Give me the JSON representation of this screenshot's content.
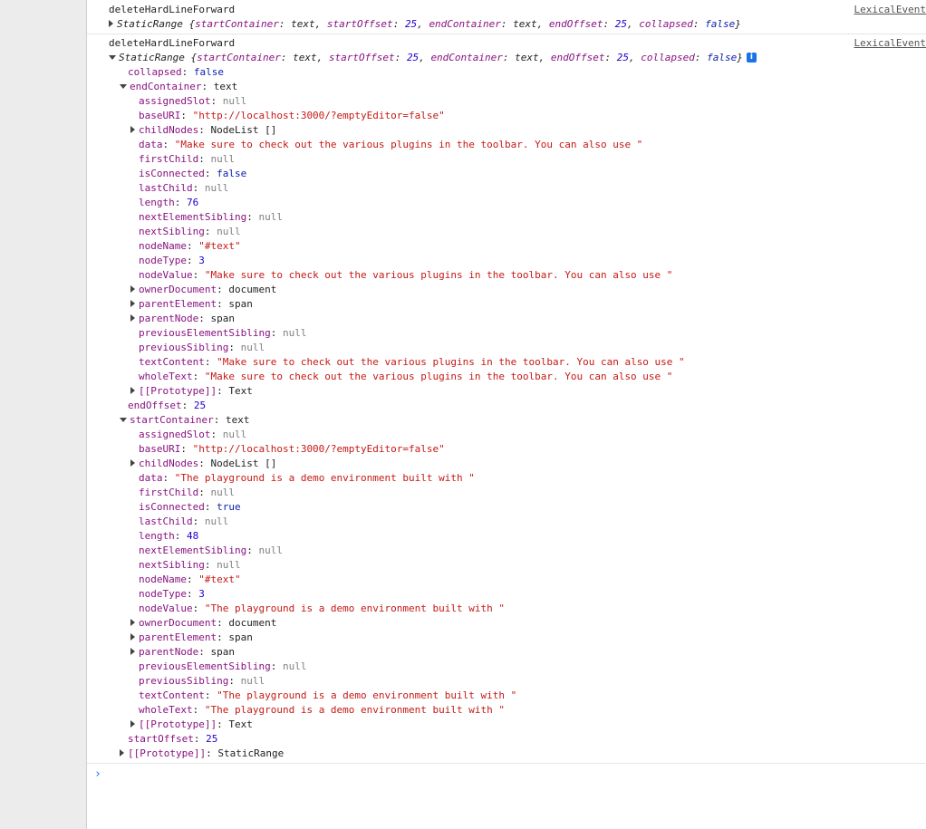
{
  "source_link": "LexicalEvent",
  "messages": [
    {
      "label": "deleteHardLineForward",
      "summary": {
        "class": "StaticRange",
        "open_brace": " {",
        "props": [
          {
            "key": "startContainer",
            "value": "text",
            "kind": "obj"
          },
          {
            "key": "startOffset",
            "value": "25",
            "kind": "num"
          },
          {
            "key": "endContainer",
            "value": "text",
            "kind": "obj"
          },
          {
            "key": "endOffset",
            "value": "25",
            "kind": "num"
          },
          {
            "key": "collapsed",
            "value": "false",
            "kind": "kw"
          }
        ],
        "close_brace": "}"
      }
    },
    {
      "label": "deleteHardLineForward",
      "summary": {
        "class": "StaticRange",
        "open_brace": " {",
        "props": [
          {
            "key": "startContainer",
            "value": "text",
            "kind": "obj"
          },
          {
            "key": "startOffset",
            "value": "25",
            "kind": "num"
          },
          {
            "key": "endContainer",
            "value": "text",
            "kind": "obj"
          },
          {
            "key": "endOffset",
            "value": "25",
            "kind": "num"
          },
          {
            "key": "collapsed",
            "value": "false",
            "kind": "kw"
          }
        ],
        "close_brace": "}"
      },
      "info_icon": "i",
      "tree": [
        {
          "depth": 0,
          "key": "collapsed",
          "value": "false",
          "kind": "kw",
          "toggle": "none"
        },
        {
          "depth": 0,
          "key": "endContainer",
          "value": "text",
          "kind": "obj",
          "toggle": "open"
        },
        {
          "depth": 1,
          "key": "assignedSlot",
          "value": "null",
          "kind": "nul",
          "toggle": "none"
        },
        {
          "depth": 1,
          "key": "baseURI",
          "value": "\"http://localhost:3000/?emptyEditor=false\"",
          "kind": "str",
          "toggle": "none"
        },
        {
          "depth": 1,
          "key": "childNodes",
          "value": "NodeList []",
          "kind": "obj",
          "toggle": "closed"
        },
        {
          "depth": 1,
          "key": "data",
          "value": "\"Make sure to check out the various plugins in the toolbar. You can also use \"",
          "kind": "str",
          "toggle": "none"
        },
        {
          "depth": 1,
          "key": "firstChild",
          "value": "null",
          "kind": "nul",
          "toggle": "none"
        },
        {
          "depth": 1,
          "key": "isConnected",
          "value": "false",
          "kind": "kw",
          "toggle": "none"
        },
        {
          "depth": 1,
          "key": "lastChild",
          "value": "null",
          "kind": "nul",
          "toggle": "none"
        },
        {
          "depth": 1,
          "key": "length",
          "value": "76",
          "kind": "num",
          "toggle": "none"
        },
        {
          "depth": 1,
          "key": "nextElementSibling",
          "value": "null",
          "kind": "nul",
          "toggle": "none"
        },
        {
          "depth": 1,
          "key": "nextSibling",
          "value": "null",
          "kind": "nul",
          "toggle": "none"
        },
        {
          "depth": 1,
          "key": "nodeName",
          "value": "\"#text\"",
          "kind": "str",
          "toggle": "none"
        },
        {
          "depth": 1,
          "key": "nodeType",
          "value": "3",
          "kind": "num",
          "toggle": "none"
        },
        {
          "depth": 1,
          "key": "nodeValue",
          "value": "\"Make sure to check out the various plugins in the toolbar. You can also use \"",
          "kind": "str",
          "toggle": "none"
        },
        {
          "depth": 1,
          "key": "ownerDocument",
          "value": "document",
          "kind": "obj",
          "toggle": "closed"
        },
        {
          "depth": 1,
          "key": "parentElement",
          "value": "span",
          "kind": "obj",
          "toggle": "closed"
        },
        {
          "depth": 1,
          "key": "parentNode",
          "value": "span",
          "kind": "obj",
          "toggle": "closed"
        },
        {
          "depth": 1,
          "key": "previousElementSibling",
          "value": "null",
          "kind": "nul",
          "toggle": "none"
        },
        {
          "depth": 1,
          "key": "previousSibling",
          "value": "null",
          "kind": "nul",
          "toggle": "none"
        },
        {
          "depth": 1,
          "key": "textContent",
          "value": "\"Make sure to check out the various plugins in the toolbar. You can also use \"",
          "kind": "str",
          "toggle": "none"
        },
        {
          "depth": 1,
          "key": "wholeText",
          "value": "\"Make sure to check out the various plugins in the toolbar. You can also use \"",
          "kind": "str",
          "toggle": "none"
        },
        {
          "depth": 1,
          "key": "[[Prototype]]",
          "value": "Text",
          "kind": "obj",
          "toggle": "closed"
        },
        {
          "depth": 0,
          "key": "endOffset",
          "value": "25",
          "kind": "num",
          "toggle": "none"
        },
        {
          "depth": 0,
          "key": "startContainer",
          "value": "text",
          "kind": "obj",
          "toggle": "open"
        },
        {
          "depth": 1,
          "key": "assignedSlot",
          "value": "null",
          "kind": "nul",
          "toggle": "none"
        },
        {
          "depth": 1,
          "key": "baseURI",
          "value": "\"http://localhost:3000/?emptyEditor=false\"",
          "kind": "str",
          "toggle": "none"
        },
        {
          "depth": 1,
          "key": "childNodes",
          "value": "NodeList []",
          "kind": "obj",
          "toggle": "closed"
        },
        {
          "depth": 1,
          "key": "data",
          "value": "\"The playground is a demo environment built with \"",
          "kind": "str",
          "toggle": "none"
        },
        {
          "depth": 1,
          "key": "firstChild",
          "value": "null",
          "kind": "nul",
          "toggle": "none"
        },
        {
          "depth": 1,
          "key": "isConnected",
          "value": "true",
          "kind": "kw",
          "toggle": "none"
        },
        {
          "depth": 1,
          "key": "lastChild",
          "value": "null",
          "kind": "nul",
          "toggle": "none"
        },
        {
          "depth": 1,
          "key": "length",
          "value": "48",
          "kind": "num",
          "toggle": "none"
        },
        {
          "depth": 1,
          "key": "nextElementSibling",
          "value": "null",
          "kind": "nul",
          "toggle": "none"
        },
        {
          "depth": 1,
          "key": "nextSibling",
          "value": "null",
          "kind": "nul",
          "toggle": "none"
        },
        {
          "depth": 1,
          "key": "nodeName",
          "value": "\"#text\"",
          "kind": "str",
          "toggle": "none"
        },
        {
          "depth": 1,
          "key": "nodeType",
          "value": "3",
          "kind": "num",
          "toggle": "none"
        },
        {
          "depth": 1,
          "key": "nodeValue",
          "value": "\"The playground is a demo environment built with \"",
          "kind": "str",
          "toggle": "none"
        },
        {
          "depth": 1,
          "key": "ownerDocument",
          "value": "document",
          "kind": "obj",
          "toggle": "closed"
        },
        {
          "depth": 1,
          "key": "parentElement",
          "value": "span",
          "kind": "obj",
          "toggle": "closed"
        },
        {
          "depth": 1,
          "key": "parentNode",
          "value": "span",
          "kind": "obj",
          "toggle": "closed"
        },
        {
          "depth": 1,
          "key": "previousElementSibling",
          "value": "null",
          "kind": "nul",
          "toggle": "none"
        },
        {
          "depth": 1,
          "key": "previousSibling",
          "value": "null",
          "kind": "nul",
          "toggle": "none"
        },
        {
          "depth": 1,
          "key": "textContent",
          "value": "\"The playground is a demo environment built with \"",
          "kind": "str",
          "toggle": "none"
        },
        {
          "depth": 1,
          "key": "wholeText",
          "value": "\"The playground is a demo environment built with \"",
          "kind": "str",
          "toggle": "none"
        },
        {
          "depth": 1,
          "key": "[[Prototype]]",
          "value": "Text",
          "kind": "obj",
          "toggle": "closed"
        },
        {
          "depth": 0,
          "key": "startOffset",
          "value": "25",
          "kind": "num",
          "toggle": "none"
        },
        {
          "depth": 0,
          "key": "[[Prototype]]",
          "value": "StaticRange",
          "kind": "obj",
          "toggle": "closed"
        }
      ]
    }
  ],
  "prompt_symbol": "›",
  "colors": {
    "key": "#881280",
    "string": "#c41a16",
    "number": "#1c00cf",
    "keyword": "#0d22aa",
    "null": "#808080",
    "prompt": "#1a73e8"
  }
}
